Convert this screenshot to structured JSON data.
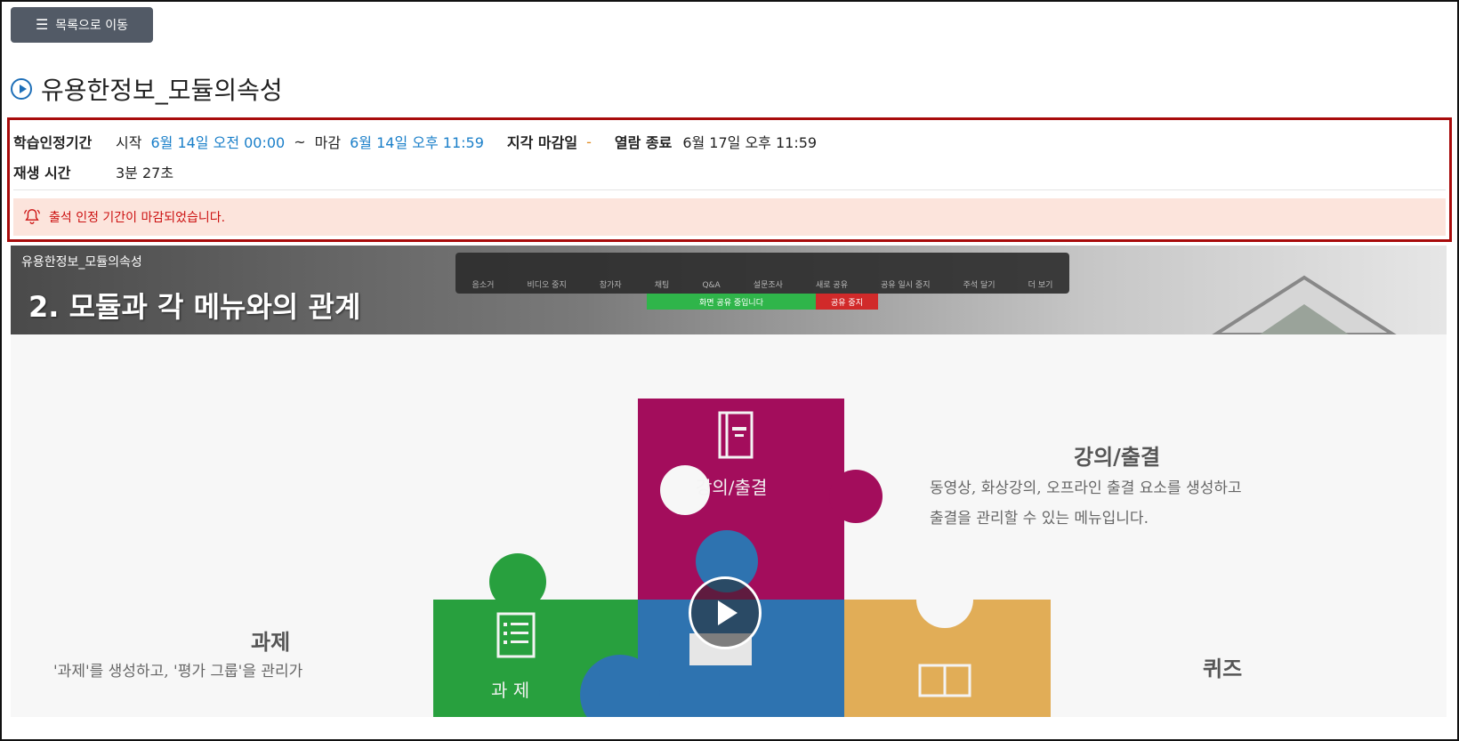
{
  "header": {
    "back_button_label": "목록으로 이동",
    "menu_icon": "hamburger-icon"
  },
  "page": {
    "title": "유용한정보_모듈의속성"
  },
  "info": {
    "period_label": "학습인정기간",
    "start_label": "시작",
    "start_value": "6월 14일 오전 00:00",
    "tilde": "~",
    "end_label": "마감",
    "end_value": "6월 14일 오후 11:59",
    "late_label": "지각 마감일",
    "late_value": "-",
    "close_label": "열람 종료",
    "close_value": "6월 17일 오후 11:59",
    "playtime_label": "재생 시간",
    "playtime_value": "3분 27초"
  },
  "alert": {
    "message": "출석 인정 기간이 마감되었습니다."
  },
  "video": {
    "title": "유용한정보_모듈의속성",
    "slide_heading": "2. 모듈과 각 메뉴와의 관계",
    "zoom_toolbar": [
      "음소거",
      "비디오 중지",
      "참가자",
      "채팅",
      "Q&A",
      "설문조사",
      "새로 공유",
      "공유 일시 중지",
      "주석 달기",
      "더 보기"
    ],
    "share_notice": "화면 공유 중입니다",
    "stop_share": "공유 중지",
    "pieces": {
      "magenta": "강의/출결",
      "green": "과 제"
    },
    "right_title": "강의/출결",
    "right_desc_1": "동영상, 화상강의, 오프라인 출결 요소를 생성하고",
    "right_desc_2": "출결을 관리할 수 있는 메뉴입니다.",
    "left_title": "과제",
    "left_desc": "'과제'를 생성하고, '평가 그룹'을 관리가",
    "bottom_right_title": "퀴즈"
  },
  "colors": {
    "accent_blue": "#1a7fc9",
    "alert_bg": "#fce4dc",
    "alert_text": "#cc1111",
    "box_border": "#a80b0b"
  }
}
